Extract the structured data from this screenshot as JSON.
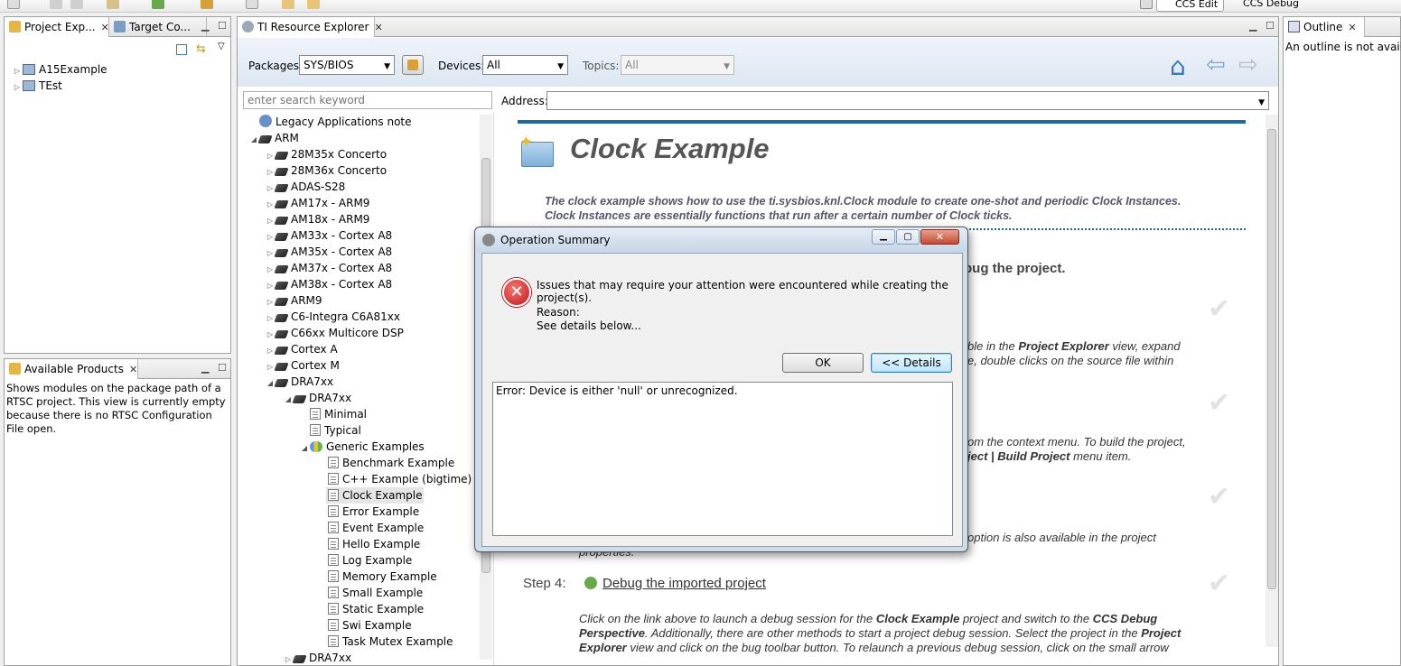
{
  "toolbar": {
    "perspective_edit": "CCS Edit",
    "perspective_debug": "CCS Debug"
  },
  "project_explorer": {
    "tab1": "Project Exp...",
    "tab2": "Target Co...",
    "items": [
      "A15Example",
      "TEst"
    ]
  },
  "available_products": {
    "tab": "Available Products",
    "message": "Shows modules on the package path of a RTSC project. This view is currently empty because there is no RTSC Configuration File open."
  },
  "resource_explorer": {
    "tab": "TI Resource Explorer",
    "packages_label": "Packages:",
    "packages_value": "SYS/BIOS",
    "devices_label": "Devices:",
    "devices_value": "All",
    "topics_label": "Topics:",
    "topics_value": "All",
    "search_placeholder": "enter search keyword",
    "address_label": "Address:",
    "tree": {
      "legacy": "Legacy Applications note",
      "arm": "ARM",
      "arm_children": [
        "28M35x Concerto",
        "28M36x Concerto",
        "ADAS-S28",
        "AM17x - ARM9",
        "AM18x - ARM9",
        "AM33x - Cortex A8",
        "AM35x - Cortex A8",
        "AM37x - Cortex A8",
        "AM38x - Cortex A8",
        "ARM9",
        "C6-Integra C6A81xx",
        "C66xx Multicore DSP",
        "Cortex A",
        "Cortex M",
        "DRA7xx"
      ],
      "dra7xx_child": "DRA7xx",
      "minimal": "Minimal",
      "typical": "Typical",
      "generic": "Generic Examples",
      "examples": [
        "Benchmark Example",
        "C++ Example (bigtime)",
        "Clock Example",
        "Error Example",
        "Event Example",
        "Hello Example",
        "Log Example",
        "Memory Example",
        "Small Example",
        "Static Example",
        "Swi Example",
        "Task Mutex Example"
      ],
      "last": "DRA7xx"
    },
    "content": {
      "title": "Clock Example",
      "description_1": "The clock example shows how to use the ti.sysbios.knl.Clock module to create one-shot and periodic Clock Instances.",
      "description_2": "Clock Instances are essentially functions that run after a certain number of Clock ticks.",
      "heading_fragment": "bug the project.",
      "step1_frag_a": "ble in the ",
      "step1_bold": "Project Explorer",
      "step1_frag_b": " view, expand",
      "step1_frag_c": "e, double clicks on the source file within",
      "step2_frag_a": "om the context menu. To build the project,",
      "step2_bold": "ject | Build Project",
      "step2_frag_b": " menu item.",
      "step3_frag": "option is also available in the project",
      "step3_frag2": "properties.",
      "step4_label": "Step 4:",
      "step4_link": "Debug the imported project",
      "step4_text_a": "Click on the link above to launch a debug session for the ",
      "step4_bold_a": "Clock Example",
      "step4_text_b": " project and switch to the ",
      "step4_bold_b": "CCS Debug",
      "step4_bold_c": "Perspective",
      "step4_text_c": ". Additionally, there are other methods to start a project debug session. Select the project in the ",
      "step4_bold_d": "Project",
      "step4_bold_e": "Explorer",
      "step4_text_d": " view and click on the bug toolbar button. To relaunch a previous debug session, click on the small arrow"
    }
  },
  "outline": {
    "tab": "Outline",
    "message": "An outline is not availab"
  },
  "dialog": {
    "title": "Operation Summary",
    "message": "Issues that may require your attention were encountered while creating the project(s).",
    "reason_label": "Reason:",
    "reason_text": "See details below...",
    "ok_label": "OK",
    "details_label": "<< Details",
    "details_text": "Error: Device is either 'null' or unrecognized."
  },
  "colors": {
    "accent_blue": "#1f6a9a",
    "error_red": "#d4202a",
    "title_text": "#555555"
  }
}
